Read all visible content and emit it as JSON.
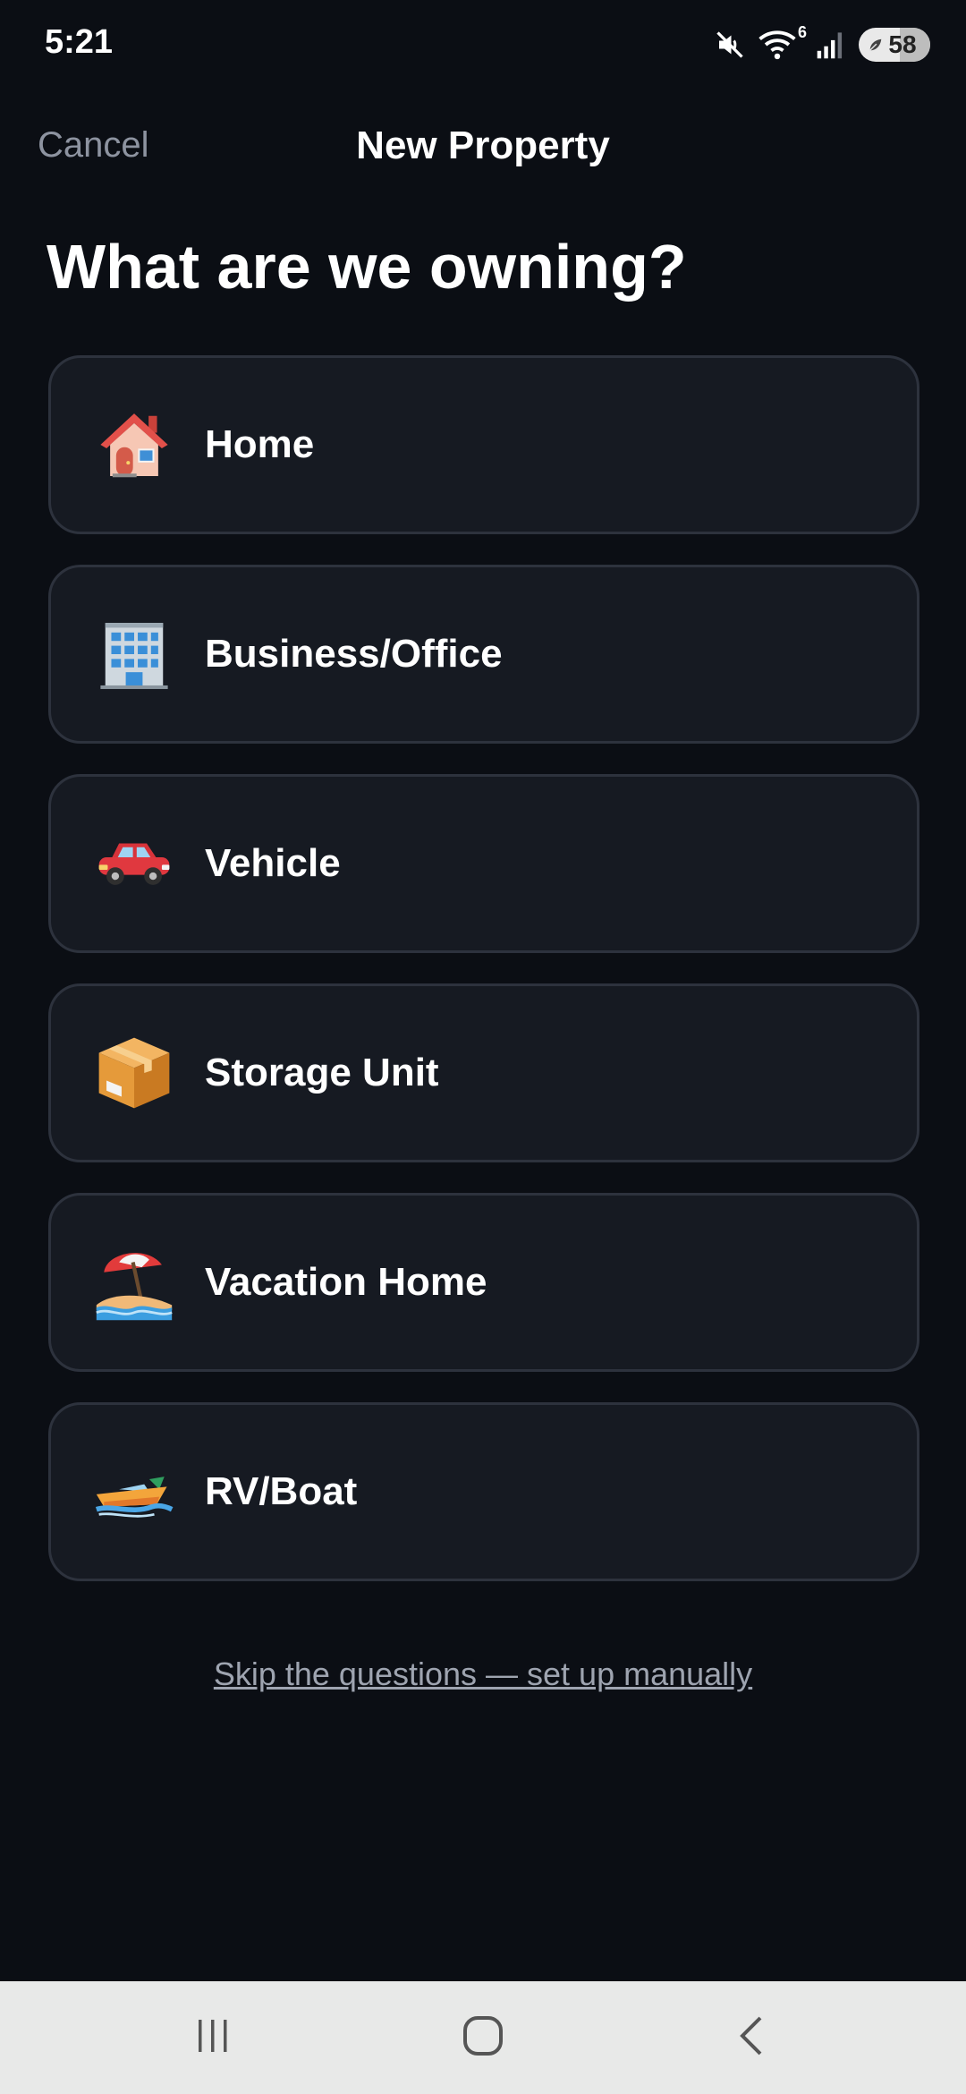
{
  "status_bar": {
    "time": "5:21",
    "wifi_label": "6",
    "battery_level": "58",
    "battery_percent": 58
  },
  "header": {
    "cancel_label": "Cancel",
    "title": "New Property"
  },
  "question": "What are we owning?",
  "options": [
    {
      "label": "Home",
      "icon": "house-icon"
    },
    {
      "label": "Business/Office",
      "icon": "office-building-icon"
    },
    {
      "label": "Vehicle",
      "icon": "car-icon"
    },
    {
      "label": "Storage Unit",
      "icon": "package-icon"
    },
    {
      "label": "Vacation Home",
      "icon": "beach-umbrella-icon"
    },
    {
      "label": "RV/Boat",
      "icon": "speedboat-icon"
    }
  ],
  "skip_link": "Skip the questions — set up manually",
  "nav_bar": {
    "icons": [
      "recent-apps-icon",
      "home-icon",
      "back-icon"
    ]
  },
  "colors": {
    "background": "#0b0e14",
    "card": "#161a22",
    "card_border": "#2d323d",
    "muted_text": "#8d93a0",
    "nav_background": "#e8e9e8"
  }
}
